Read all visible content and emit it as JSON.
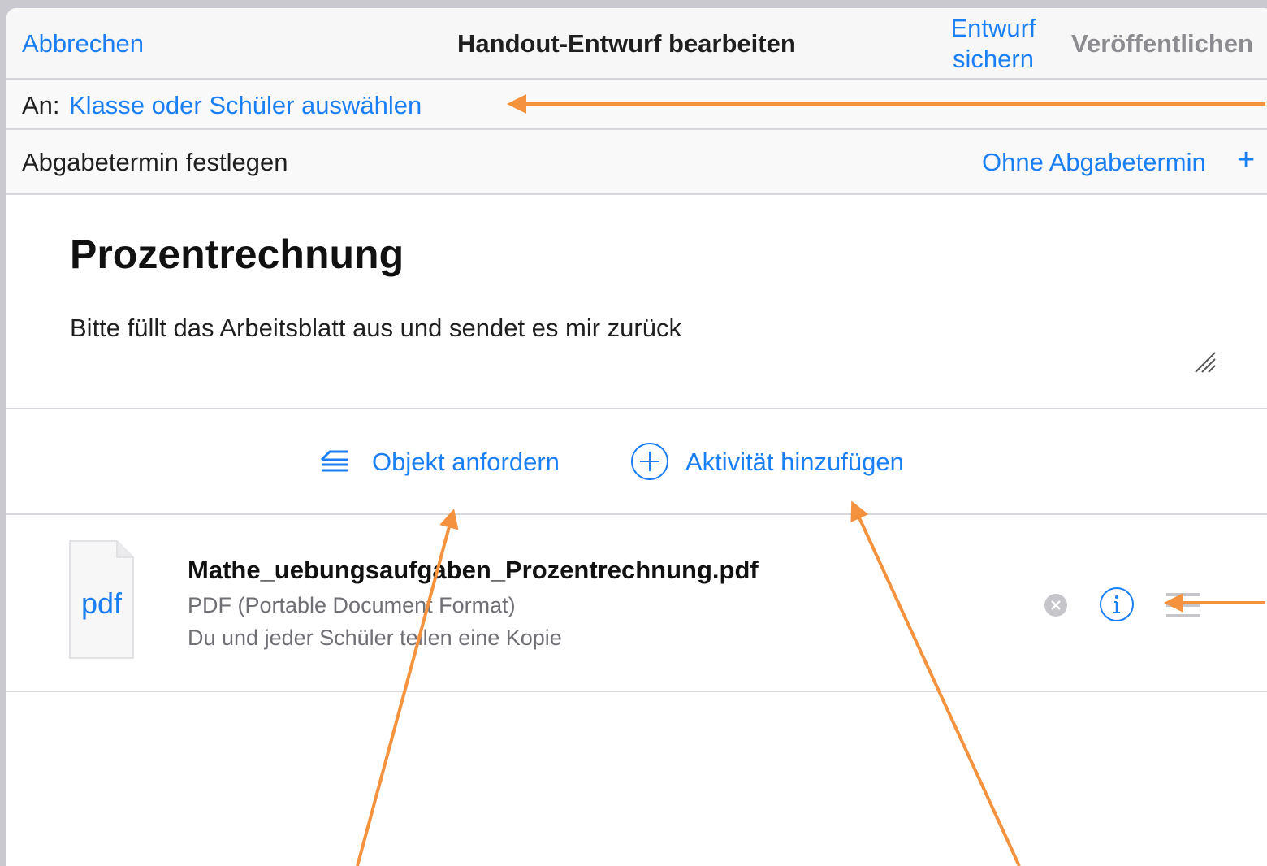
{
  "navbar": {
    "cancel_label": "Abbrechen",
    "title": "Handout-Entwurf bearbeiten",
    "save_draft_label": "Entwurf sichern",
    "publish_label": "Veröffentlichen"
  },
  "recipients": {
    "label": "An:",
    "placeholder": "Klasse oder Schüler auswählen"
  },
  "due_date": {
    "label": "Abgabetermin festlegen",
    "value": "Ohne Abgabetermin",
    "add_icon": "plus-icon"
  },
  "handout": {
    "title": "Prozentrechnung",
    "description": "Bitte füllt das Arbeitsblatt aus und sendet es mir zurück"
  },
  "actions": {
    "request_item_label": "Objekt anfordern",
    "request_item_icon": "tray-stack-icon",
    "add_activity_label": "Aktivität hinzufügen",
    "add_activity_icon": "plus-circle-icon"
  },
  "attachment": {
    "icon_label": "pdf",
    "file_name": "Mathe_uebungsaufgaben_Prozentrechnung.pdf",
    "file_type": "PDF (Portable Document Format)",
    "sharing": "Du und jeder Schüler teilen eine Kopie"
  },
  "colors": {
    "accent": "#1a7ff5",
    "annotation_arrow": "#f5923e",
    "disabled": "#8b8b90"
  }
}
